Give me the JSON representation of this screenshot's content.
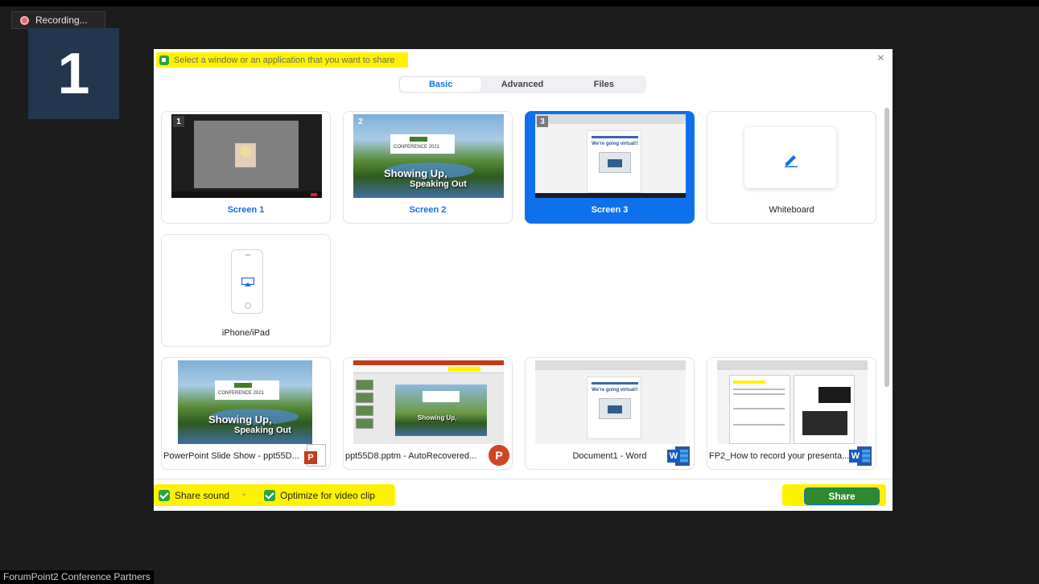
{
  "recording": {
    "label": "Recording..."
  },
  "screen_indicator": {
    "number": "1"
  },
  "participant_name": "ForumPoint2 Conference Partners",
  "dialog": {
    "title": "Select a window or an application that you want to share",
    "tabs": [
      {
        "label": "Basic",
        "active": true
      },
      {
        "label": "Advanced",
        "active": false
      },
      {
        "label": "Files",
        "active": false
      }
    ],
    "items": [
      {
        "label": "Screen 1",
        "badge": "1"
      },
      {
        "label": "Screen 2",
        "badge": "2"
      },
      {
        "label": "Screen 3",
        "badge": "3",
        "selected": true
      },
      {
        "label": "Whiteboard"
      },
      {
        "label": "iPhone/iPad"
      },
      {
        "label": "PowerPoint Slide Show  -  ppt55D...",
        "app_icon": "powerpoint-doc-icon"
      },
      {
        "label": "ppt55D8.pptm  -  AutoRecovered...",
        "app_icon": "powerpoint-icon"
      },
      {
        "label": "Document1 - Word",
        "app_icon": "word-icon"
      },
      {
        "label": "FP2_How to record your presenta...",
        "app_icon": "word-icon"
      }
    ],
    "thumb_text": {
      "slide_line1": "Showing Up,",
      "slide_line2": "Speaking Out",
      "doc_heading": "We're going virtual!!"
    },
    "options": {
      "share_sound": "Share sound",
      "optimize_video": "Optimize for video clip"
    },
    "share_button": "Share",
    "close_glyph": "×"
  },
  "colors": {
    "accent_blue": "#0e71eb",
    "highlight_yellow": "#fff200",
    "check_green": "#2ca24a",
    "share_green": "#2d8b2d"
  }
}
